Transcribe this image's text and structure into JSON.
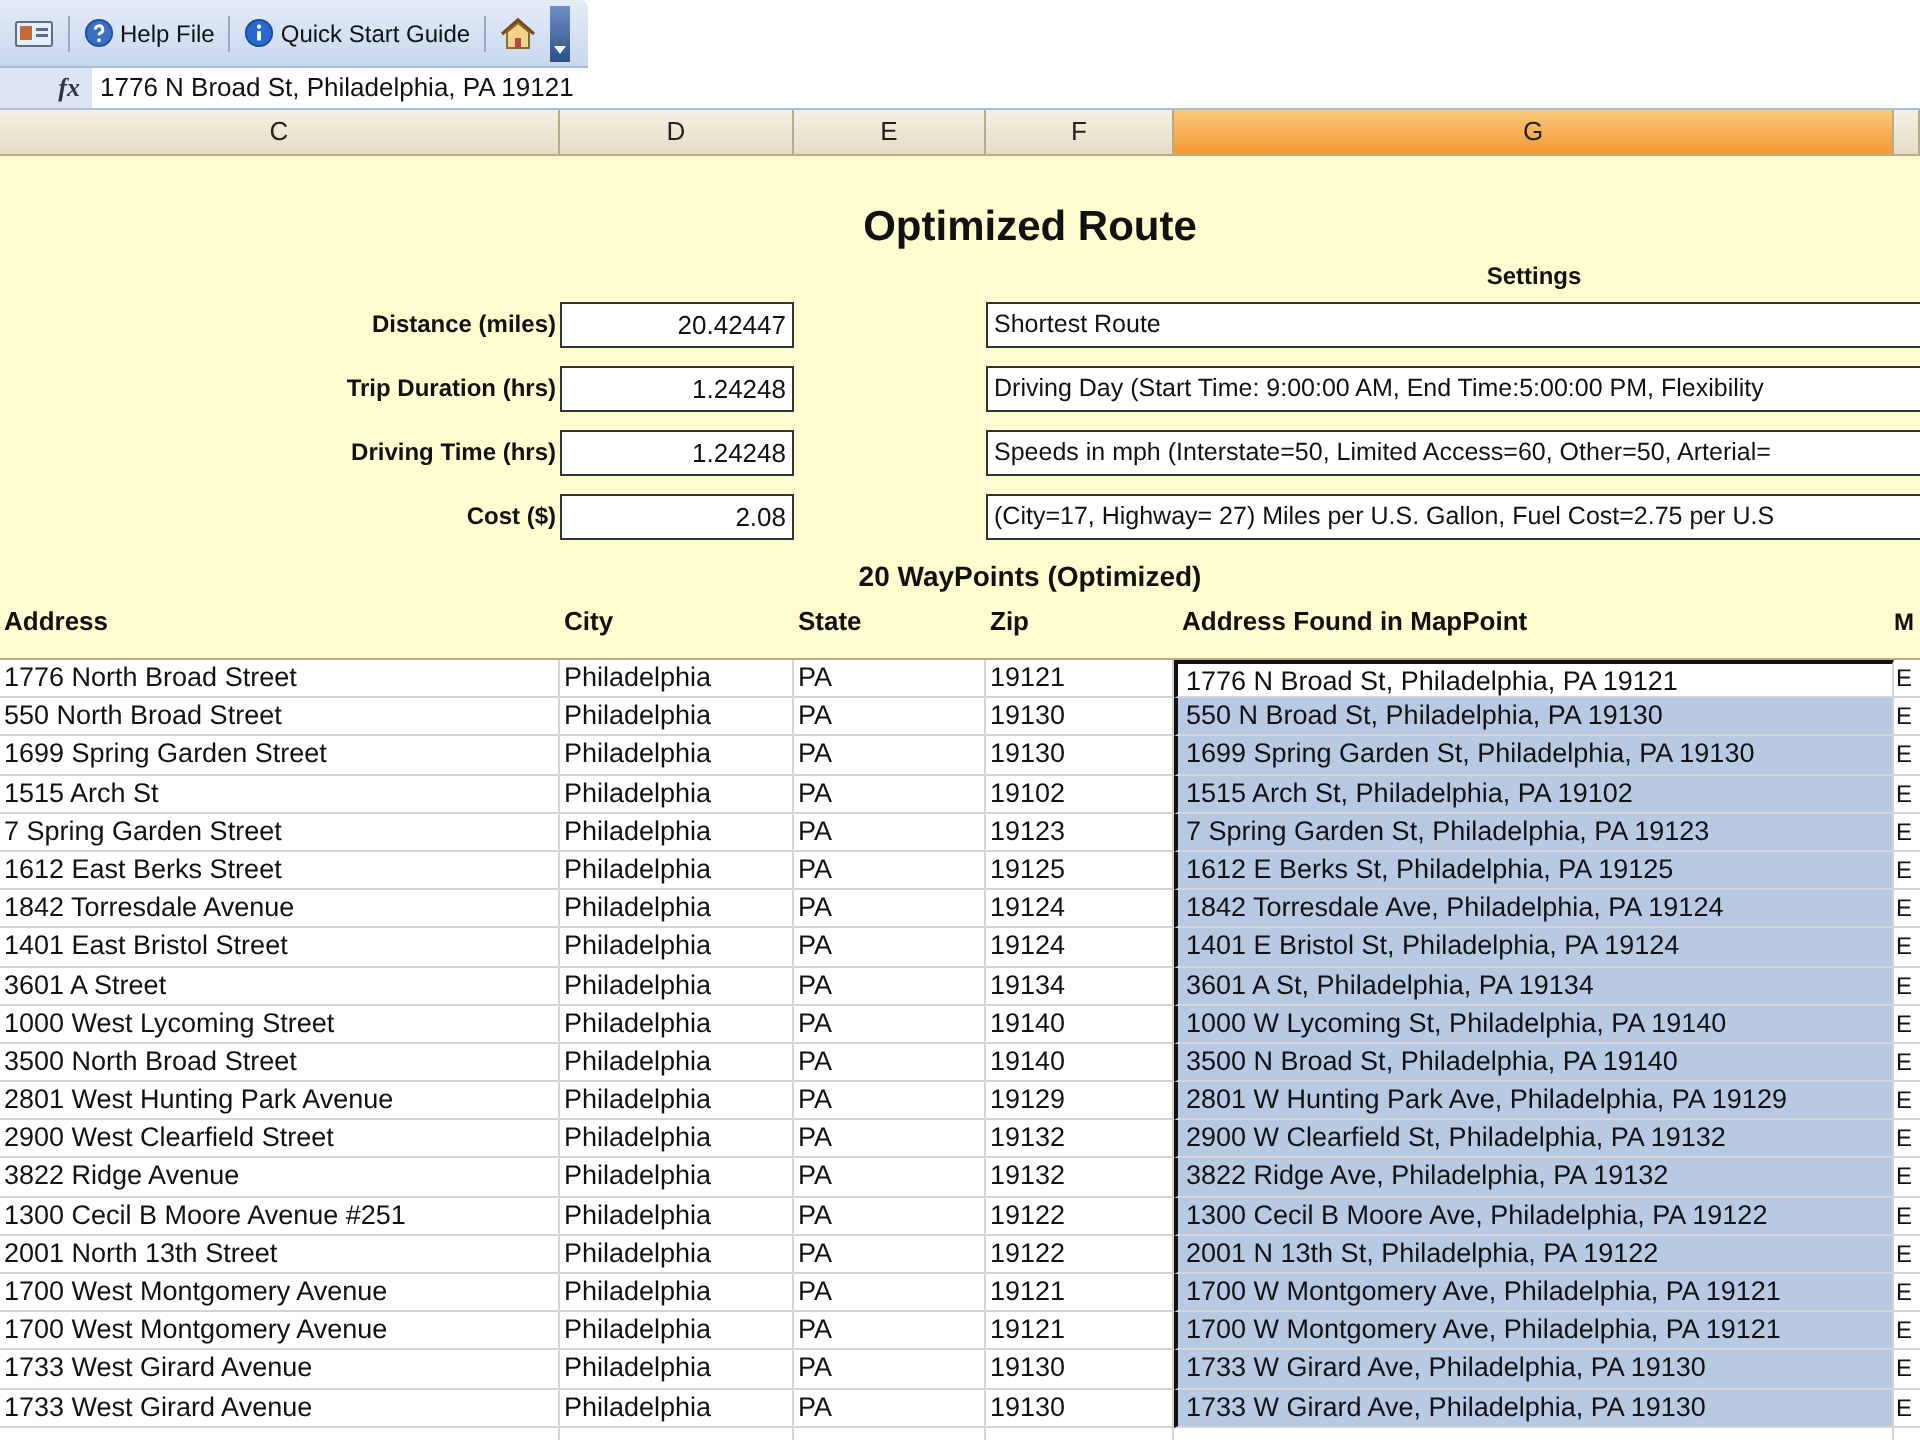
{
  "toolbar": {
    "buttons": [
      {
        "kind": "card"
      },
      {
        "kind": "help",
        "label": "Help File"
      },
      {
        "kind": "info",
        "label": "Quick Start Guide"
      },
      {
        "kind": "home"
      }
    ]
  },
  "formula_bar": {
    "label": "fx",
    "value": "1776 N Broad St, Philadelphia, PA 19121"
  },
  "column_headers": [
    {
      "label": "C",
      "selected": false
    },
    {
      "label": "D",
      "selected": false
    },
    {
      "label": "E",
      "selected": false
    },
    {
      "label": "F",
      "selected": false
    },
    {
      "label": "G",
      "selected": true
    }
  ],
  "title": "Optimized Route",
  "settings_heading": "Settings",
  "summary": [
    {
      "label": "Distance (miles)",
      "value": "20.42447",
      "setting": "Shortest Route"
    },
    {
      "label": "Trip Duration (hrs)",
      "value": "1.24248",
      "setting": "Driving Day (Start Time: 9:00:00 AM, End Time:5:00:00 PM, Flexibility"
    },
    {
      "label": "Driving Time (hrs)",
      "value": "1.24248",
      "setting": "Speeds in mph (Interstate=50, Limited Access=60, Other=50, Arterial="
    },
    {
      "label": "Cost ($)",
      "value": "2.08",
      "setting": "(City=17, Highway= 27) Miles per U.S. Gallon, Fuel Cost=2.75 per U.S"
    }
  ],
  "waypoints_heading": "20 WayPoints (Optimized)",
  "table": {
    "columns": [
      "Address",
      "City",
      "State",
      "Zip",
      "Address Found in MapPoint",
      "M"
    ],
    "rows": [
      {
        "address": "1776 North Broad Street",
        "city": "Philadelphia",
        "state": "PA",
        "zip": "19121",
        "found": "1776 N Broad St, Philadelphia, PA 19121",
        "column_6": "E",
        "selected": true,
        "active": true
      },
      {
        "address": "550 North Broad Street",
        "city": "Philadelphia",
        "state": "PA",
        "zip": "19130",
        "found": "550 N Broad St, Philadelphia, PA 19130",
        "column_6": "E",
        "selected": true,
        "active": false
      },
      {
        "address": "1699 Spring Garden Street",
        "city": "Philadelphia",
        "state": "PA",
        "zip": "19130",
        "found": "1699 Spring Garden St, Philadelphia, PA 19130",
        "column_6": "E",
        "selected": true,
        "active": false
      },
      {
        "address": "1515 Arch St",
        "city": "Philadelphia",
        "state": "PA",
        "zip": "19102",
        "found": "1515 Arch St, Philadelphia, PA 19102",
        "column_6": "E",
        "selected": true,
        "active": false
      },
      {
        "address": "7 Spring Garden Street",
        "city": "Philadelphia",
        "state": "PA",
        "zip": "19123",
        "found": "7 Spring Garden St, Philadelphia, PA 19123",
        "column_6": "E",
        "selected": true,
        "active": false
      },
      {
        "address": "1612 East Berks Street",
        "city": "Philadelphia",
        "state": "PA",
        "zip": "19125",
        "found": "1612 E Berks St, Philadelphia, PA 19125",
        "column_6": "E",
        "selected": true,
        "active": false
      },
      {
        "address": "1842 Torresdale Avenue",
        "city": "Philadelphia",
        "state": "PA",
        "zip": "19124",
        "found": "1842 Torresdale Ave, Philadelphia, PA 19124",
        "column_6": "E",
        "selected": true,
        "active": false
      },
      {
        "address": "1401 East Bristol Street",
        "city": "Philadelphia",
        "state": "PA",
        "zip": "19124",
        "found": "1401 E Bristol St, Philadelphia, PA 19124",
        "column_6": "E",
        "selected": true,
        "active": false
      },
      {
        "address": "3601 A Street",
        "city": "Philadelphia",
        "state": "PA",
        "zip": "19134",
        "found": "3601 A St, Philadelphia, PA 19134",
        "column_6": "E",
        "selected": true,
        "active": false
      },
      {
        "address": "1000 West Lycoming Street",
        "city": "Philadelphia",
        "state": "PA",
        "zip": "19140",
        "found": "1000 W Lycoming St, Philadelphia, PA 19140",
        "column_6": "E",
        "selected": true,
        "active": false
      },
      {
        "address": "3500 North Broad Street",
        "city": "Philadelphia",
        "state": "PA",
        "zip": "19140",
        "found": "3500 N Broad St, Philadelphia, PA 19140",
        "column_6": "E",
        "selected": true,
        "active": false
      },
      {
        "address": "2801 West Hunting Park Avenue",
        "city": "Philadelphia",
        "state": "PA",
        "zip": "19129",
        "found": "2801 W Hunting Park Ave, Philadelphia, PA 19129",
        "column_6": "E",
        "selected": true,
        "active": false
      },
      {
        "address": "2900 West Clearfield Street",
        "city": "Philadelphia",
        "state": "PA",
        "zip": "19132",
        "found": "2900 W Clearfield St, Philadelphia, PA 19132",
        "column_6": "E",
        "selected": true,
        "active": false
      },
      {
        "address": "3822 Ridge Avenue",
        "city": "Philadelphia",
        "state": "PA",
        "zip": "19132",
        "found": "3822 Ridge Ave, Philadelphia, PA 19132",
        "column_6": "E",
        "selected": true,
        "active": false
      },
      {
        "address": "1300 Cecil B Moore Avenue #251",
        "city": "Philadelphia",
        "state": "PA",
        "zip": "19122",
        "found": "1300 Cecil B Moore Ave, Philadelphia, PA 19122",
        "column_6": "E",
        "selected": true,
        "active": false
      },
      {
        "address": "2001 North 13th Street",
        "city": "Philadelphia",
        "state": "PA",
        "zip": "19122",
        "found": "2001 N 13th St, Philadelphia, PA 19122",
        "column_6": "E",
        "selected": true,
        "active": false
      },
      {
        "address": "1700 West Montgomery Avenue",
        "city": "Philadelphia",
        "state": "PA",
        "zip": "19121",
        "found": "1700 W Montgomery Ave, Philadelphia, PA 19121",
        "column_6": "E",
        "selected": true,
        "active": false
      },
      {
        "address": "1700 West Montgomery Avenue",
        "city": "Philadelphia",
        "state": "PA",
        "zip": "19121",
        "found": "1700 W Montgomery Ave, Philadelphia, PA 19121",
        "column_6": "E",
        "selected": true,
        "active": false
      },
      {
        "address": "1733 West Girard Avenue",
        "city": "Philadelphia",
        "state": "PA",
        "zip": "19130",
        "found": "1733 W Girard Ave, Philadelphia, PA 19130",
        "column_6": "E",
        "selected": true,
        "active": false
      },
      {
        "address": "1733 West Girard Avenue",
        "city": "Philadelphia",
        "state": "PA",
        "zip": "19130",
        "found": "1733 W Girard Ave, Philadelphia, PA 19130",
        "column_6": "E",
        "selected": true,
        "active": false
      }
    ]
  }
}
